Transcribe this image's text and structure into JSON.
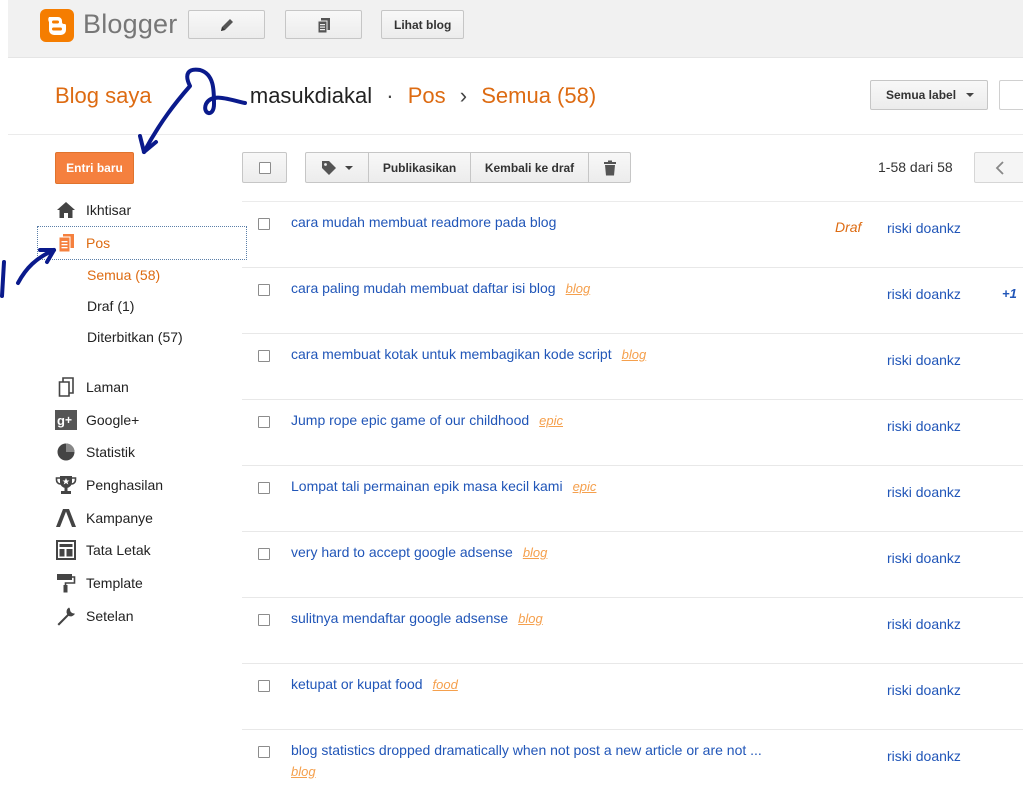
{
  "topbar": {
    "brand": "Blogger",
    "compose_icon": "pencil-icon",
    "pages_icon": "copy-pages-icon",
    "view_blog_label": "Lihat blog"
  },
  "breadcrumb": {
    "my_blogs": "Blog saya",
    "blog_name": "masukdiakal",
    "dot": "·",
    "section": "Pos",
    "arrow": "›",
    "filter": "Semua (58)"
  },
  "label_filter": {
    "label": "Semua label"
  },
  "sidebar": {
    "new_post_label": "Entri baru",
    "items": [
      {
        "label": "Ikhtisar",
        "icon": "home-icon"
      },
      {
        "label": "Pos",
        "icon": "posts-icon"
      },
      {
        "label": "Laman",
        "icon": "page-icon"
      },
      {
        "label": "Google+",
        "icon": "google-plus-icon"
      },
      {
        "label": "Statistik",
        "icon": "pie-chart-icon"
      },
      {
        "label": "Penghasilan",
        "icon": "trophy-icon"
      },
      {
        "label": "Kampanye",
        "icon": "adwords-icon"
      },
      {
        "label": "Tata Letak",
        "icon": "layout-icon"
      },
      {
        "label": "Template",
        "icon": "paint-roller-icon"
      },
      {
        "label": "Setelan",
        "icon": "wrench-icon"
      }
    ],
    "post_subitems": [
      {
        "label": "Semua (58)"
      },
      {
        "label": "Draf (1)"
      },
      {
        "label": "Diterbitkan (57)"
      }
    ]
  },
  "toolbar": {
    "label_icon": "tag-icon",
    "publish_label": "Publikasikan",
    "revert_label": "Kembali ke draf",
    "delete_icon": "trash-icon",
    "pager_text": "1-58 dari 58",
    "prev_icon": "chevron-left-icon"
  },
  "posts": [
    {
      "title": "cara mudah membuat readmore pada blog",
      "label": "",
      "status": "Draf",
      "author": "riski doankz",
      "extra": ""
    },
    {
      "title": "cara paling mudah membuat daftar isi blog",
      "label": "blog",
      "status": "",
      "author": "riski doankz",
      "extra": "+1"
    },
    {
      "title": "cara membuat kotak untuk membagikan kode script",
      "label": "blog",
      "status": "",
      "author": "riski doankz",
      "extra": ""
    },
    {
      "title": "Jump rope epic game of our childhood",
      "label": "epic",
      "status": "",
      "author": "riski doankz",
      "extra": ""
    },
    {
      "title": "Lompat tali permainan epik masa kecil kami",
      "label": "epic",
      "status": "",
      "author": "riski doankz",
      "extra": ""
    },
    {
      "title": "very hard to accept google adsense",
      "label": "blog",
      "status": "",
      "author": "riski doankz",
      "extra": ""
    },
    {
      "title": "sulitnya mendaftar google adsense",
      "label": "blog",
      "status": "",
      "author": "riski doankz",
      "extra": ""
    },
    {
      "title": "ketupat or kupat food",
      "label": "food",
      "status": "",
      "author": "riski doankz",
      "extra": ""
    },
    {
      "title": "blog statistics dropped dramatically when not post a new article or are not ...",
      "label": "blog",
      "status": "",
      "author": "riski doankz",
      "extra": ""
    }
  ],
  "colors": {
    "accent": "#dd6b12",
    "button_orange": "#f5803e",
    "link_blue": "#2156b8",
    "label_orange": "#f5a04d",
    "annotation_ink": "#0a1a8c"
  }
}
